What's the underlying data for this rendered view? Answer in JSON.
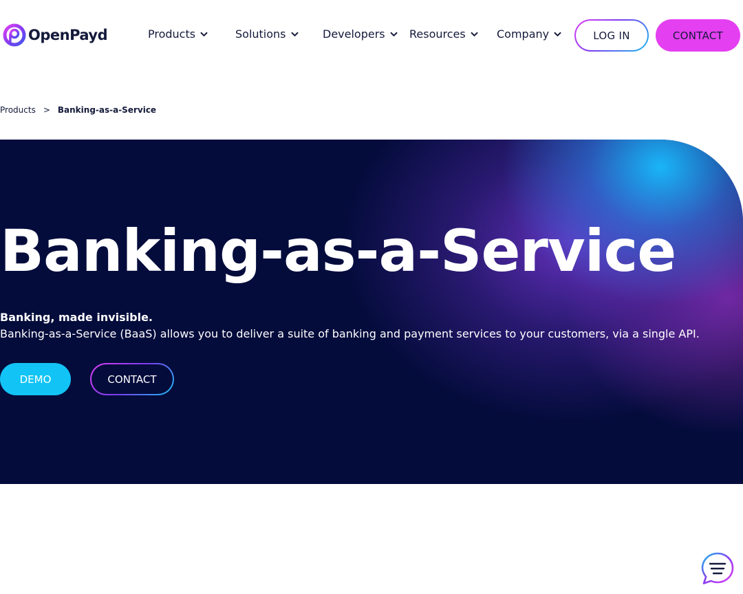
{
  "brand": {
    "name": "OpenPayd",
    "logo_icon": "openpayd-logo-icon",
    "colors": {
      "navy": "#040c3c",
      "magenta": "#e43ff0",
      "cyan": "#12c4f5",
      "purple": "#7b3df0"
    }
  },
  "nav": {
    "items": [
      {
        "label": "Products",
        "icon": "chevron-down-icon"
      },
      {
        "label": "Solutions",
        "icon": "chevron-down-icon"
      },
      {
        "label": "Developers",
        "icon": "chevron-down-icon"
      },
      {
        "label": "Resources",
        "icon": "chevron-down-icon"
      },
      {
        "label": "Company",
        "icon": "chevron-down-icon"
      }
    ],
    "login_label": "LOG IN",
    "contact_label": "CONTACT"
  },
  "breadcrumb": {
    "parent": "Products",
    "separator": ">",
    "current": "Banking-as-a-Service"
  },
  "hero": {
    "title": "Banking-as-a-Service",
    "tagline": "Banking, made invisible.",
    "description": "Banking-as-a-Service (BaaS) allows you to deliver a suite of banking and payment services to your customers, via a single API.",
    "demo_label": "DEMO",
    "contact_label": "CONTACT"
  },
  "chat": {
    "icon": "chat-bubble-icon"
  }
}
